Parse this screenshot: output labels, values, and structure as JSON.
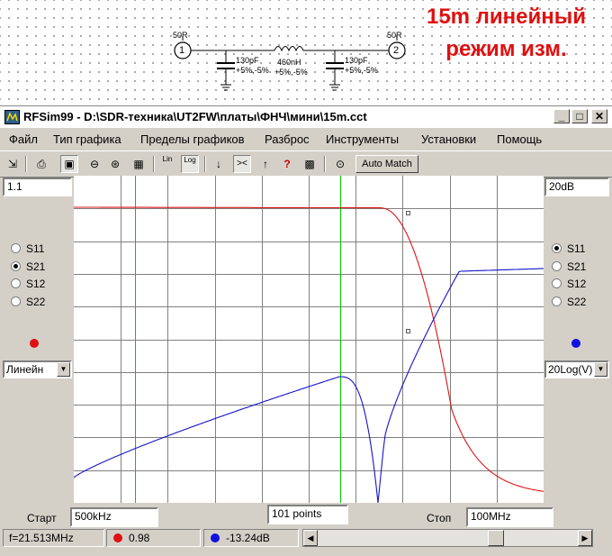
{
  "schematic": {
    "port1": {
      "impedance": "50R",
      "number": "1"
    },
    "port2": {
      "impedance": "50R",
      "number": "2"
    },
    "c1": {
      "value": "130pF",
      "tolerance": "+5%,-5%"
    },
    "l1": {
      "value": "460nH",
      "tolerance": "+5%,-5%"
    },
    "c2": {
      "value": "130pF",
      "tolerance": "+5%,-5%"
    },
    "annotation_line1": "15m линейный",
    "annotation_line2": "режим изм.",
    "annotation_color": "#e01010"
  },
  "window": {
    "title": "RFSim99 - D:\\SDR-техника\\UT2FW\\платы\\ФНЧ\\мини\\15m.cct",
    "minimize": "_",
    "maximize": "□",
    "close": "✕"
  },
  "menu": [
    "Файл",
    "Тип графика",
    "Пределы графиков",
    "Разброс",
    "Инструменты",
    "Установки",
    "Помощь"
  ],
  "toolbar": {
    "lin_label": "Lin",
    "log_label": "Log",
    "auto_match": "Auto Match"
  },
  "left_panel": {
    "scale_value": "1.1",
    "params": [
      "S11",
      "S21",
      "S12",
      "S22"
    ],
    "selected": "S21",
    "marker_color": "#e01010",
    "scale_mode": "Линейн"
  },
  "right_panel": {
    "scale_value": "20dB",
    "params": [
      "S11",
      "S21",
      "S12",
      "S22"
    ],
    "selected": "S11",
    "marker_color": "#1010e0",
    "scale_mode": "20Log(V)"
  },
  "bottom": {
    "start_label": "Старт",
    "start_value": "500kHz",
    "points": "101 points",
    "stop_label": "Стоп",
    "stop_value": "100MHz"
  },
  "status": {
    "frequency": "f=21.513MHz",
    "red_value": "0.98",
    "blue_value": "-13.24dB"
  },
  "colors": {
    "red_trace": "#dc1414",
    "blue_trace": "#1414c8",
    "grid": "#808080",
    "marker_lines": "#00cc00"
  }
}
